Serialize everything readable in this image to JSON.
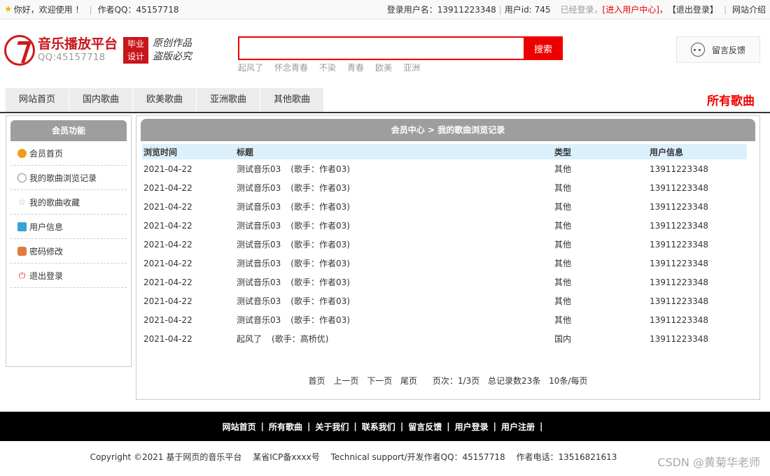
{
  "topbar": {
    "greeting": "你好，欢迎使用 ！",
    "author_qq": "作者QQ：45157718",
    "login_user": "登录用户名：13911223348",
    "user_id": "用户id: 745",
    "logged_status": "已经登录，",
    "user_center": "[进入用户中心]",
    "comma": "，",
    "logout": "【退出登录】",
    "site_intro": "网站介绍"
  },
  "logo": {
    "title": "音乐播放平台",
    "qq": "QQ:45157718",
    "badge_line1": "毕业",
    "badge_line2": "设计",
    "slogan_line1": "原创作品",
    "slogan_line2": "盗版必究"
  },
  "search": {
    "button": "搜索",
    "value": "",
    "hotwords": [
      "起风了",
      "怀念青春",
      "不染",
      "青春",
      "欧美",
      "亚洲"
    ]
  },
  "feedback": {
    "label": "留言反馈"
  },
  "nav": {
    "items": [
      "网站首页",
      "国内歌曲",
      "欧美歌曲",
      "亚洲歌曲",
      "其他歌曲"
    ],
    "right_label": "所有歌曲"
  },
  "sidebar": {
    "title": "会员功能",
    "items": [
      {
        "label": "会员首页",
        "icon": "home-icon",
        "color": "#f39a1e"
      },
      {
        "label": "我的歌曲浏览记录",
        "icon": "history-icon",
        "color": "#888888"
      },
      {
        "label": "我的歌曲收藏",
        "icon": "star-icon",
        "color": "#aaaaaa"
      },
      {
        "label": "用户信息",
        "icon": "user-card-icon",
        "color": "#3aa0d8"
      },
      {
        "label": "密码修改",
        "icon": "lock-icon",
        "color": "#e27c3c"
      },
      {
        "label": "退出登录",
        "icon": "power-icon",
        "color": "#d9442c"
      }
    ]
  },
  "main": {
    "title": "会员中心 > 我的歌曲浏览记录",
    "columns": [
      "浏览时间",
      "标题",
      "类型",
      "用户信息"
    ],
    "rows": [
      {
        "time": "2021-04-22",
        "title": "测试音乐03",
        "singer": "(歌手：作者03)",
        "type": "其他",
        "user": "13911223348"
      },
      {
        "time": "2021-04-22",
        "title": "测试音乐03",
        "singer": "(歌手：作者03)",
        "type": "其他",
        "user": "13911223348"
      },
      {
        "time": "2021-04-22",
        "title": "测试音乐03",
        "singer": "(歌手：作者03)",
        "type": "其他",
        "user": "13911223348"
      },
      {
        "time": "2021-04-22",
        "title": "测试音乐03",
        "singer": "(歌手：作者03)",
        "type": "其他",
        "user": "13911223348"
      },
      {
        "time": "2021-04-22",
        "title": "测试音乐03",
        "singer": "(歌手：作者03)",
        "type": "其他",
        "user": "13911223348"
      },
      {
        "time": "2021-04-22",
        "title": "测试音乐03",
        "singer": "(歌手：作者03)",
        "type": "其他",
        "user": "13911223348"
      },
      {
        "time": "2021-04-22",
        "title": "测试音乐03",
        "singer": "(歌手：作者03)",
        "type": "其他",
        "user": "13911223348"
      },
      {
        "time": "2021-04-22",
        "title": "测试音乐03",
        "singer": "(歌手：作者03)",
        "type": "其他",
        "user": "13911223348"
      },
      {
        "time": "2021-04-22",
        "title": "测试音乐03",
        "singer": "(歌手：作者03)",
        "type": "其他",
        "user": "13911223348"
      },
      {
        "time": "2021-04-22",
        "title": "起风了",
        "singer": "(歌手：高桥优)",
        "type": "国内",
        "user": "13911223348"
      }
    ],
    "pager": {
      "first": "首页",
      "prev": "上一页",
      "next": "下一页",
      "last": "尾页",
      "page_info": "页次：1/3页",
      "total": "总记录数23条",
      "per_page": "10条/每页"
    }
  },
  "footer": {
    "links": [
      "网站首页",
      "所有歌曲",
      "关于我们",
      "联系我们",
      "留言反馈",
      "用户登录",
      "用户注册"
    ],
    "separator": "|",
    "copyright": "Copyright ©2021 基于网页的音乐平台",
    "icp": "某省ICP备xxxx号",
    "support": "Technical support/开发作者QQ：45157718",
    "phone": "作者电话：13516821613",
    "watermark": "CSDN @黄菊华老师"
  }
}
